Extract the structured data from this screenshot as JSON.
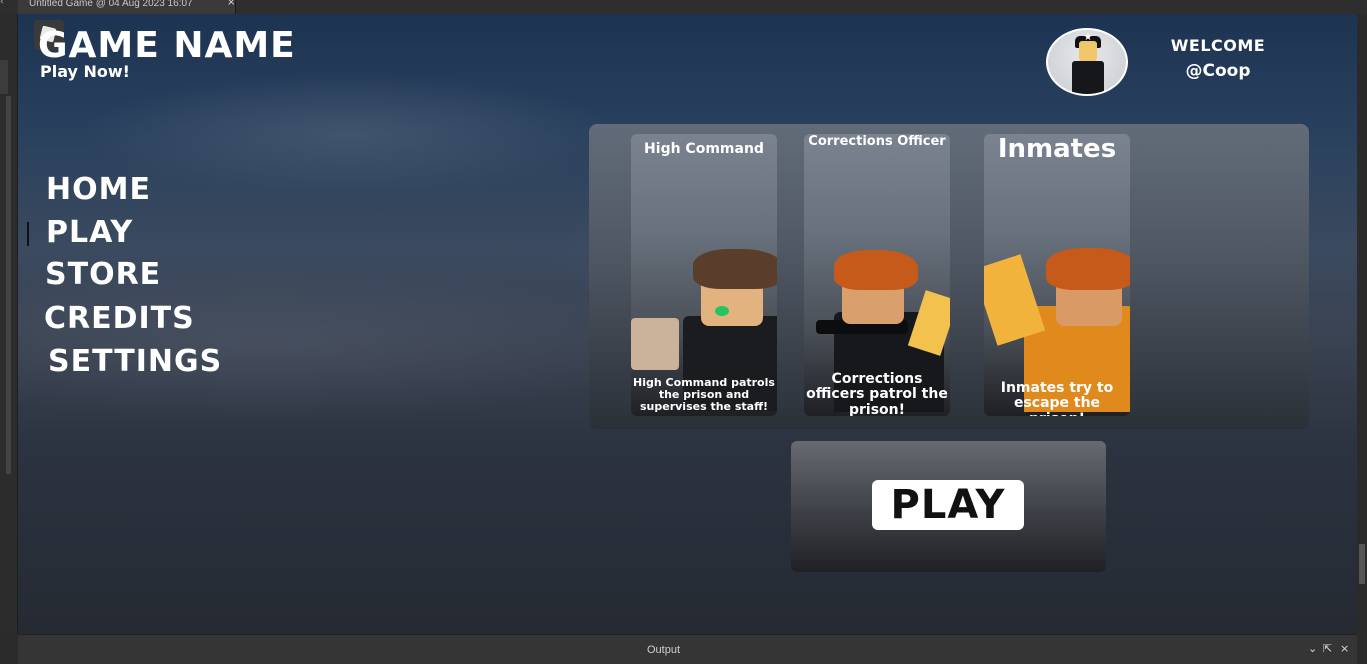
{
  "studio": {
    "tab_title": "Untitled Game @ 04 Aug 2023 16:07",
    "tab_close": "×",
    "output_title": "Output",
    "output_buttons": [
      "⌄",
      "⇱",
      "×"
    ]
  },
  "game": {
    "title": "GAME NAME",
    "subtitle": "Play Now!",
    "welcome": "WELCOME",
    "username": "@Coop",
    "avatar_badge": "★",
    "nav": [
      "HOME",
      "PLAY",
      "STORE",
      "CREDITS",
      "SETTINGS"
    ],
    "active_nav": "PLAY",
    "teams": [
      {
        "title": "High Command",
        "description": "High Command patrols the prison and supervises the staff!"
      },
      {
        "title": "Corrections Officer",
        "description": "Corrections officers patrol the prison!"
      },
      {
        "title": "Inmates",
        "description": "Inmates try to escape the prison!"
      }
    ],
    "play_label": "PLAY"
  },
  "colors": {
    "text": "#ffffff",
    "play_button_bg": "#ffffff",
    "play_button_text": "#111111",
    "hair_brown": "#5a3d2a",
    "hair_orange": "#c65a1a",
    "skin": "#d9a06e",
    "uniform_black": "#16181b",
    "prisoner_orange": "#e08a1e"
  }
}
